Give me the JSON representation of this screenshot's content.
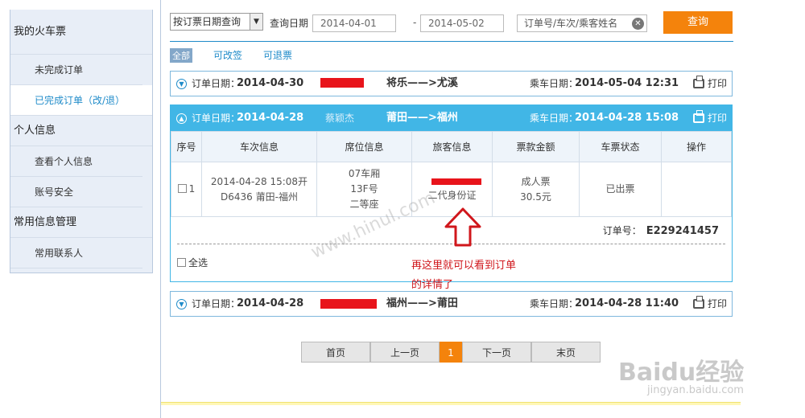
{
  "sidebar": {
    "section1": "我的火车票",
    "items1": [
      "未完成订单",
      "已完成订单（改/退）"
    ],
    "section2": "个人信息",
    "items2": [
      "查看个人信息",
      "账号安全"
    ],
    "section3": "常用信息管理",
    "items3": [
      "常用联系人"
    ]
  },
  "filter": {
    "select_value": "按订票日期查询",
    "date_label": "查询日期",
    "date_from": "2014-04-01",
    "separator": "-",
    "date_to": "2014-05-02",
    "search_placeholder": "订单号/车次/乘客姓名",
    "query_label": "查询"
  },
  "tabs": [
    "全部",
    "可改签",
    "可退票"
  ],
  "orders": [
    {
      "order_date_label": "订单日期：",
      "order_date": "2014-04-30",
      "route": "将乐——>尤溪",
      "ride_label": "乘车日期：",
      "ride_date": "2014-05-04 12:31",
      "print_label": "打印"
    },
    {
      "order_date_label": "订单日期：",
      "order_date": "2014-04-28",
      "passenger": "蔡颖杰",
      "route": "莆田——>福州",
      "ride_label": "乘车日期：",
      "ride_date": "2014-04-28 15:08",
      "print_label": "打印",
      "columns": [
        "序号",
        "车次信息",
        "席位信息",
        "旅客信息",
        "票款金额",
        "车票状态",
        "操作"
      ],
      "row": {
        "index": "1",
        "train_line1": "2014-04-28 15:08开",
        "train_line2": "D6436 莆田-福州",
        "seat_line1": "07车厢",
        "seat_line2": "13F号",
        "seat_line3": "二等座",
        "passenger_id_type": "二代身份证",
        "ticket_type": "成人票",
        "price": "30.5元",
        "status": "已出票",
        "action": ""
      },
      "order_no_label": "订单号：",
      "order_no": "E229241457",
      "select_all": "全选"
    },
    {
      "order_date_label": "订单日期：",
      "order_date": "2014-04-28",
      "route": "福州——>莆田",
      "ride_label": "乘车日期：",
      "ride_date": "2014-04-28 11:40",
      "print_label": "打印"
    }
  ],
  "pager": {
    "first": "首页",
    "prev": "上一页",
    "current": "1",
    "next": "下一页",
    "last": "末页"
  },
  "annotation": {
    "text": "再这里就可以看到订单的详情了"
  },
  "watermark": {
    "site": "www.hinul.com",
    "logo": "Baidu经验",
    "sub": "jingyan.baidu.com"
  },
  "colors": {
    "accent": "#41b6e6",
    "link": "#1f8bc9",
    "orange": "#f4830c",
    "redact": "#e8141b",
    "annotation": "#d0171c"
  }
}
